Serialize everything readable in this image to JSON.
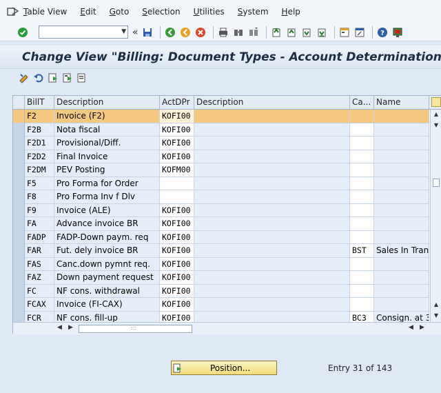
{
  "menu": {
    "items": [
      {
        "underlined": "T",
        "rest": "able View"
      },
      {
        "underlined": "E",
        "rest": "dit"
      },
      {
        "underlined": "G",
        "rest": "oto"
      },
      {
        "underlined": "S",
        "rest": "election"
      },
      {
        "underlined": "U",
        "rest": "tilities"
      },
      {
        "underlined": "S",
        "rest": "ystem"
      },
      {
        "underlined": "H",
        "rest": "elp"
      }
    ]
  },
  "toolbar": {
    "command_value": "",
    "back_arrows": "«"
  },
  "title": "Change View \"Billing: Document Types - Account Determination",
  "table": {
    "headers": {
      "billt": "BillT",
      "desc": "Description",
      "act": "ActDPr",
      "desc2": "Description",
      "ca": "Ca...",
      "name": "Name"
    },
    "rows": [
      {
        "billt": "F2",
        "desc": "Invoice (F2)",
        "act": "KOFI00",
        "desc2": "",
        "ca": "",
        "name": ""
      },
      {
        "billt": "F2B",
        "desc": "Nota fiscal",
        "act": "KOFI00",
        "desc2": "",
        "ca": "",
        "name": ""
      },
      {
        "billt": "F2D1",
        "desc": "Provisional/Diff.",
        "act": "KOFI00",
        "desc2": "",
        "ca": "",
        "name": ""
      },
      {
        "billt": "F2D2",
        "desc": "Final Invoice",
        "act": "KOFI00",
        "desc2": "",
        "ca": "",
        "name": ""
      },
      {
        "billt": "F2DM",
        "desc": "PEV Posting",
        "act": "KOFM00",
        "desc2": "",
        "ca": "",
        "name": ""
      },
      {
        "billt": "F5",
        "desc": "Pro Forma for Order",
        "act": "",
        "desc2": "",
        "ca": "",
        "name": ""
      },
      {
        "billt": "F8",
        "desc": "Pro Forma Inv f Dlv",
        "act": "",
        "desc2": "",
        "ca": "",
        "name": ""
      },
      {
        "billt": "F9",
        "desc": "Invoice (ALE)",
        "act": "KOFI00",
        "desc2": "",
        "ca": "",
        "name": ""
      },
      {
        "billt": "FA",
        "desc": "Advance invoice BR",
        "act": "KOFI00",
        "desc2": "",
        "ca": "",
        "name": ""
      },
      {
        "billt": "FADP",
        "desc": "FADP-Down paym. req",
        "act": "KOFI00",
        "desc2": "",
        "ca": "",
        "name": ""
      },
      {
        "billt": "FAR",
        "desc": "Fut. dely invoice BR",
        "act": "KOFI00",
        "desc2": "",
        "ca": "BST",
        "name": "Sales In Tran"
      },
      {
        "billt": "FAS",
        "desc": "Canc.down pymnt req.",
        "act": "KOFI00",
        "desc2": "",
        "ca": "",
        "name": ""
      },
      {
        "billt": "FAZ",
        "desc": "Down payment request",
        "act": "KOFI00",
        "desc2": "",
        "ca": "",
        "name": ""
      },
      {
        "billt": "FC",
        "desc": "NF cons. withdrawal",
        "act": "KOFI00",
        "desc2": "",
        "ca": "",
        "name": ""
      },
      {
        "billt": "FCAX",
        "desc": "Invoice (FI-CAX)",
        "act": "KOFI00",
        "desc2": "",
        "ca": "",
        "name": ""
      },
      {
        "billt": "FCR",
        "desc": "NF cons. fill-up",
        "act": "KOFI00",
        "desc2": "",
        "ca": "BC3",
        "name": "Consign. at 3"
      }
    ],
    "highlighted_row": 0,
    "hscroll_grip": ":::"
  },
  "footer": {
    "position_button": "Position...",
    "entry_label": "Entry",
    "entry_current": "31",
    "entry_of": "of",
    "entry_total": "143"
  },
  "colors": {
    "highlight": "#f4c880",
    "title_text": "#1d2d44",
    "accent_green": "#2a9d3a"
  }
}
